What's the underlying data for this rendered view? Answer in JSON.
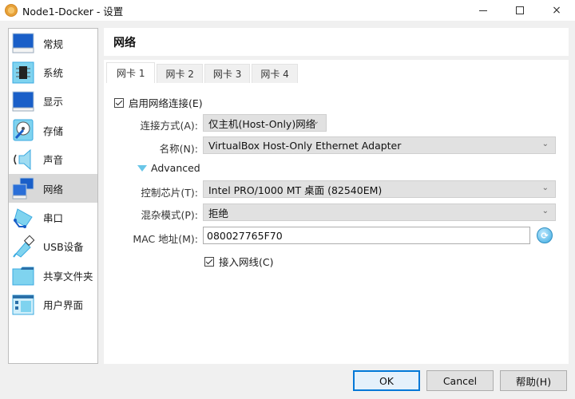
{
  "window": {
    "title": "Node1-Docker - 设置",
    "controls": {
      "minimize": "minimize-icon",
      "maximize": "maximize-icon",
      "close": "×"
    }
  },
  "sidebar": {
    "items": [
      {
        "label": "常规",
        "icon": "general-monitor-icon",
        "active": false
      },
      {
        "label": "系统",
        "icon": "system-chip-icon",
        "active": false
      },
      {
        "label": "显示",
        "icon": "display-monitor-icon",
        "active": false
      },
      {
        "label": "存储",
        "icon": "storage-disk-icon",
        "active": false
      },
      {
        "label": "声音",
        "icon": "audio-speaker-icon",
        "active": false
      },
      {
        "label": "网络",
        "icon": "network-icon",
        "active": true
      },
      {
        "label": "串口",
        "icon": "serial-port-icon",
        "active": false
      },
      {
        "label": "USB设备",
        "icon": "usb-icon",
        "active": false
      },
      {
        "label": "共享文件夹",
        "icon": "shared-folder-icon",
        "active": false
      },
      {
        "label": "用户界面",
        "icon": "user-interface-icon",
        "active": false
      }
    ]
  },
  "panel": {
    "title": "网络",
    "tabs": [
      {
        "label": "网卡 1",
        "active": true
      },
      {
        "label": "网卡 2",
        "active": false
      },
      {
        "label": "网卡 3",
        "active": false
      },
      {
        "label": "网卡 4",
        "active": false
      }
    ],
    "enable_adapter": {
      "label": "启用网络连接(E)",
      "checked": true
    },
    "attached_to": {
      "label": "连接方式(A):",
      "value": "仅主机(Host-Only)网络"
    },
    "name": {
      "label": "名称(N):",
      "value": "VirtualBox Host-Only Ethernet Adapter"
    },
    "advanced": {
      "label": "Advanced",
      "expanded": true
    },
    "adapter_type": {
      "label": "控制芯片(T):",
      "value": "Intel PRO/1000 MT 桌面 (82540EM)"
    },
    "promiscuous": {
      "label": "混杂模式(P):",
      "value": "拒绝"
    },
    "mac": {
      "label": "MAC 地址(M):",
      "value": "080027765F70"
    },
    "cable": {
      "label": "接入网线(C)",
      "checked": true
    }
  },
  "buttons": {
    "ok": "OK",
    "cancel": "Cancel",
    "help": "帮助(H)"
  },
  "colors": {
    "accent": "#0078d7",
    "selected_bg": "#d9d9d9",
    "icon_blue": "#3aa9e0"
  }
}
